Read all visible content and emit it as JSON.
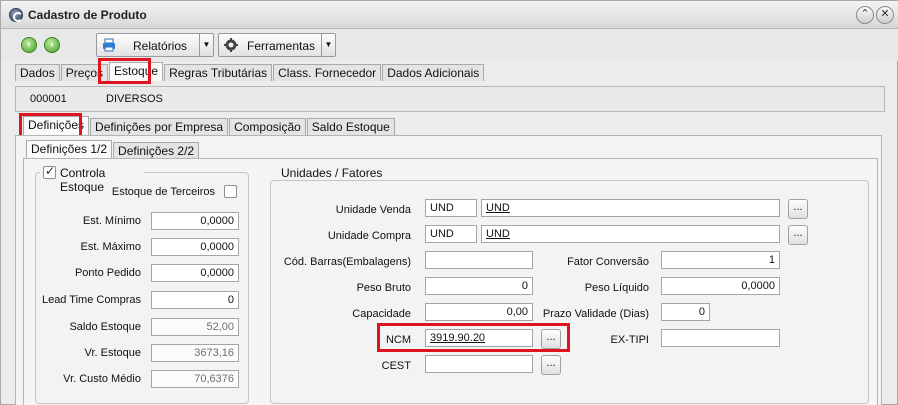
{
  "window": {
    "title": "Cadastro de Produto"
  },
  "toolbar": {
    "reports_label": "Relatórios",
    "tools_label": "Ferramentas"
  },
  "main_tabs": [
    "Dados",
    "Preços",
    "Estoque",
    "Regras Tributárias",
    "Class. Fornecedor",
    "Dados Adicionais"
  ],
  "product": {
    "code": "000001",
    "name": "DIVERSOS"
  },
  "sub_tabs": [
    "Definições",
    "Definições por Empresa",
    "Composição",
    "Saldo Estoque"
  ],
  "inner_tabs": [
    "Definições 1/2",
    "Definições 2/2"
  ],
  "stock": {
    "title": "Controla Estoque",
    "checked": true,
    "third_party_label": "Estoque de Terceiros",
    "third_party_checked": false,
    "fields": [
      {
        "label": "Est. Mínimo",
        "value": "0,0000",
        "readonly": false
      },
      {
        "label": "Est. Máximo",
        "value": "0,0000",
        "readonly": false
      },
      {
        "label": "Ponto Pedido",
        "value": "0,0000",
        "readonly": false
      },
      {
        "label": "Lead Time Compras",
        "value": "0",
        "readonly": false
      },
      {
        "label": "Saldo Estoque",
        "value": "52,00",
        "readonly": true
      },
      {
        "label": "Vr. Estoque",
        "value": "3673,16",
        "readonly": true
      },
      {
        "label": "Vr. Custo Médio",
        "value": "70,6376",
        "readonly": true
      }
    ]
  },
  "units": {
    "title": "Unidades / Fatores",
    "sale_unit_label": "Unidade Venda",
    "sale_unit_code": "UND",
    "sale_unit_desc": "UND",
    "purchase_unit_label": "Unidade Compra",
    "purchase_unit_code": "UND",
    "purchase_unit_desc": "UND",
    "barcode_label": "Cód. Barras(Embalagens)",
    "barcode_value": "",
    "conversion_label": "Fator Conversão",
    "conversion_value": "1",
    "gross_weight_label": "Peso Bruto",
    "gross_weight_value": "0",
    "net_weight_label": "Peso Líquido",
    "net_weight_value": "0,0000",
    "capacity_label": "Capacidade",
    "capacity_value": "0,00",
    "validity_label": "Prazo Validade (Dias)",
    "validity_value": "0",
    "ncm_label": "NCM",
    "ncm_value": "3919.90.20",
    "extipi_label": "EX-TIPI",
    "extipi_value": "",
    "cest_label": "CEST",
    "cest_value": "",
    "ellipsis": "..."
  },
  "colors": {
    "highlight": "#e0141e",
    "go_button": "#4a9e2a"
  }
}
